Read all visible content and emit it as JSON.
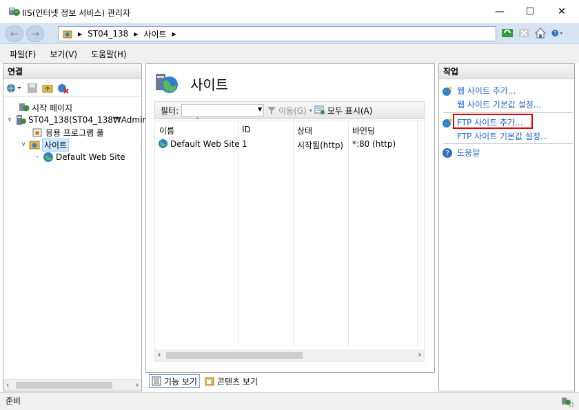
{
  "window": {
    "title": "IIS(인터넷 정보 서비스) 관리자",
    "minimize": "—",
    "maximize": "☐",
    "close": "✕"
  },
  "address": {
    "crumbs": [
      "ST04_138",
      "사이트"
    ]
  },
  "menu": [
    "파일(F)",
    "보기(V)",
    "도움말(H)"
  ],
  "connections": {
    "title": "연결",
    "tree": [
      {
        "label": "시작 페이지"
      },
      {
        "label": "ST04_138(ST04_138₩Admin"
      },
      {
        "label": "응용 프로그램 풀"
      },
      {
        "label": "사이트"
      },
      {
        "label": "Default Web Site"
      }
    ]
  },
  "main": {
    "title": "사이트",
    "filter_label": "필터:",
    "go_label": "이동(G)",
    "show_all_label": "모두 표시(A)",
    "columns": [
      "이름",
      "ID",
      "상태",
      "바인딩"
    ],
    "rows": [
      {
        "name": "Default Web Site",
        "id": "1",
        "status": "시작됨(http)",
        "binding": "*:80 (http)"
      }
    ],
    "features_view": "기능 보기",
    "content_view": "콘텐츠 보기"
  },
  "actions": {
    "title": "작업",
    "add_web_site": "웹 사이트 추가...",
    "web_site_defaults": "웹 사이트 기본값 설정...",
    "add_ftp_site": "FTP 사이트 추가...",
    "ftp_site_defaults": "FTP 사이트 기본값 설정...",
    "help": "도움말"
  },
  "status": {
    "text": "준비"
  }
}
